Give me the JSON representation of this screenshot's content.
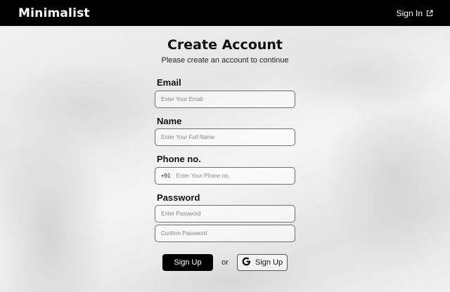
{
  "header": {
    "brand": "Minimalist",
    "signin_label": "Sign In",
    "signin_icon": "external-link-icon"
  },
  "form": {
    "title": "Create Account",
    "subtitle": "Please create an account to continue",
    "email": {
      "label": "Email",
      "placeholder": "Enter Your Email",
      "value": ""
    },
    "name": {
      "label": "Name",
      "placeholder": "Enter Your Full Name",
      "value": ""
    },
    "phone": {
      "label": "Phone no.",
      "prefix": "+91",
      "placeholder": "Enter Your Phone no.",
      "value": ""
    },
    "password": {
      "label": "Password",
      "placeholder": "Enter Password",
      "value": ""
    },
    "confirm_password": {
      "placeholder": "Confirm Password",
      "value": ""
    }
  },
  "actions": {
    "signup_label": "Sign Up",
    "separator": "or",
    "google_signup_label": "Sign Up",
    "google_icon": "google-icon"
  },
  "colors": {
    "header_bg": "#000000",
    "primary_button": "#000000",
    "text": "#111111"
  }
}
